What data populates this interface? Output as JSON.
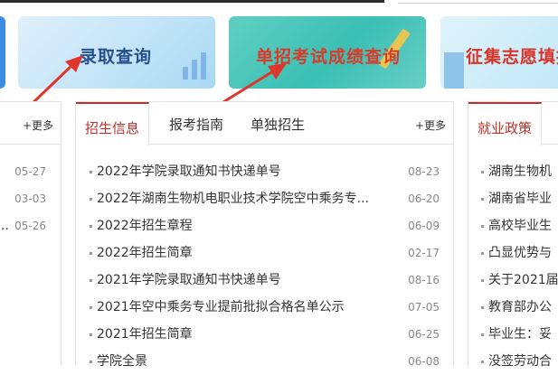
{
  "banners": [
    {
      "title": "录取查询"
    },
    {
      "title": "单招考试成绩查询"
    },
    {
      "title": "征集志愿填报"
    }
  ],
  "left_panel": {
    "more": "+更多",
    "items": [
      {
        "text": "",
        "date": "05-27"
      },
      {
        "text": "",
        "date": "03-03"
      },
      {
        "text": "..",
        "date": "05-26"
      }
    ]
  },
  "middle_panel": {
    "tabs": [
      "招生信息",
      "报考指南",
      "单独招生"
    ],
    "more": "+更多",
    "items": [
      {
        "title": "2022年学院录取通知书快递单号",
        "date": "08-23"
      },
      {
        "title": "2022年湖南生物机电职业技术学院空中乘务专...",
        "date": "06-20"
      },
      {
        "title": "2022年招生章程",
        "date": "06-09"
      },
      {
        "title": "2022年招生简章",
        "date": "02-17"
      },
      {
        "title": "2021年学院录取通知书快递单号",
        "date": "08-16"
      },
      {
        "title": "2021年空中乘务专业提前批拟合格名单公示",
        "date": "07-05"
      },
      {
        "title": "2021年招生简章",
        "date": "06-25"
      },
      {
        "title": "学院全景",
        "date": "06-08"
      }
    ]
  },
  "right_panel": {
    "tab": "就业政策",
    "items": [
      {
        "title": "湖南生物机"
      },
      {
        "title": "湖南省毕业"
      },
      {
        "title": "高校毕业生"
      },
      {
        "title": "凸显优势与"
      },
      {
        "title": "关于2021届"
      },
      {
        "title": "教育部办公"
      },
      {
        "title": "毕业生：妥"
      },
      {
        "title": "没签劳动合"
      }
    ]
  },
  "colors": {
    "accent": "#c0302a",
    "arrow": "#e0352b"
  }
}
